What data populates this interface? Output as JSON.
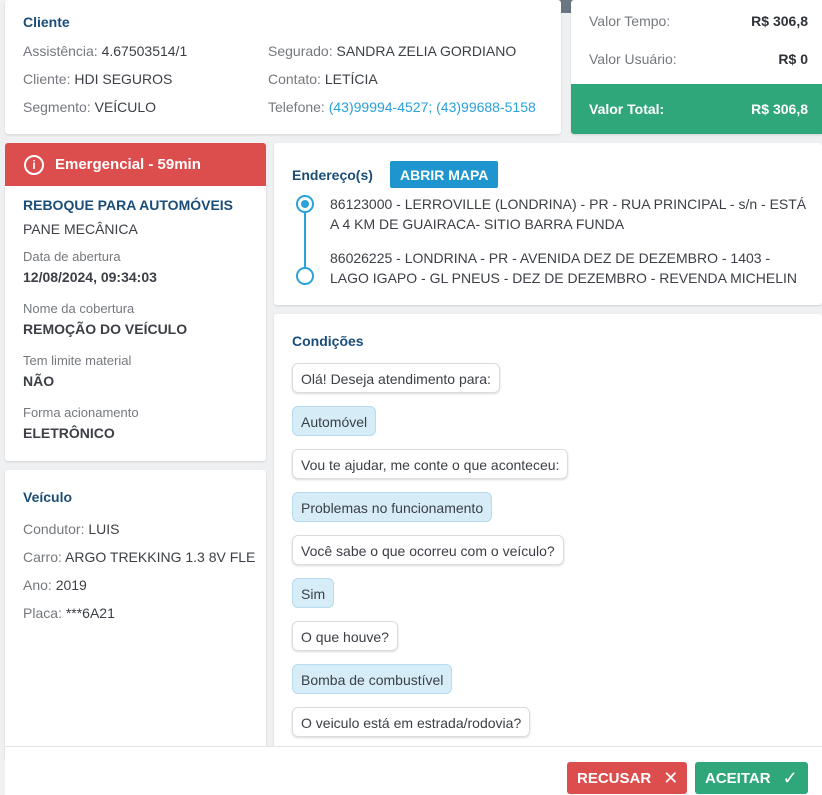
{
  "client": {
    "title": "Cliente",
    "assistance_label": "Assistência:",
    "assistance": "4.67503514/1",
    "client_label": "Cliente:",
    "client": "HDI SEGUROS",
    "segment_label": "Segmento:",
    "segment": "VEÍCULO",
    "insured_label": "Segurado:",
    "insured": "SANDRA ZELIA GORDIANO",
    "contact_label": "Contato:",
    "contact": "LETÍCIA",
    "phone_label": "Telefone:",
    "phone": "(43)99994-4527; (43)99688-5158"
  },
  "values": {
    "time_label": "Valor Tempo:",
    "time": "R$ 306,8",
    "user_label": "Valor Usuário:",
    "user": "R$ 0",
    "total_label": "Valor Total:",
    "total": "R$ 306,8"
  },
  "service": {
    "emergency": "Emergencial - 59min",
    "type": "REBOQUE PARA AUTOMÓVEIS",
    "problem": "PANE MECÂNICA",
    "opening_label": "Data de abertura",
    "opening": "12/08/2024, 09:34:03",
    "coverage_label": "Nome da cobertura",
    "coverage": "REMOÇÃO DO VEÍCULO",
    "material_label": "Tem limite material",
    "material": "NÃO",
    "trigger_label": "Forma acionamento",
    "trigger": "ELETRÔNICO"
  },
  "vehicle": {
    "title": "Veículo",
    "driver_label": "Condutor:",
    "driver": "LUIS",
    "car_label": "Carro:",
    "car": "ARGO TREKKING 1.3 8V FLE",
    "year_label": "Ano:",
    "year": "2019",
    "plate_label": "Placa:",
    "plate": "***6A21"
  },
  "address": {
    "title": "Endereço(s)",
    "map_button": "ABRIR MAPA",
    "origin": "86123000 - LERROVILLE (LONDRINA) - PR - RUA PRINCIPAL - s/n - ESTÁ A 4 KM DE GUAIRACA- SITIO BARRA FUNDA",
    "destination": "86026225 - LONDRINA - PR - AVENIDA DEZ DE DEZEMBRO - 1403 - LAGO IGAPO - GL PNEUS - DEZ DE DEZEMBRO - REVENDA MICHELIN"
  },
  "conditions": {
    "title": "Condições",
    "messages": [
      {
        "kind": "q",
        "text": "Olá! Deseja atendimento para:"
      },
      {
        "kind": "a",
        "text": "Automóvel"
      },
      {
        "kind": "q",
        "text": "Vou te ajudar, me conte o que aconteceu:"
      },
      {
        "kind": "a",
        "text": "Problemas no funcionamento"
      },
      {
        "kind": "q",
        "text": "Você sabe o que ocorreu com o veículo?"
      },
      {
        "kind": "a",
        "text": "Sim"
      },
      {
        "kind": "q",
        "text": "O que houve?"
      },
      {
        "kind": "a",
        "text": "Bomba de combustível"
      },
      {
        "kind": "q",
        "text": "O veiculo está em estrada/rodovia?"
      }
    ]
  },
  "actions": {
    "refuse": "RECUSAR",
    "accept": "ACEITAR"
  },
  "colors": {
    "brand_blue": "#1a4d78",
    "link": "#2aa1d9",
    "success": "#30a67b",
    "danger": "#dc4d4d"
  },
  "icons": {
    "emergency": "alert-circle-icon",
    "refuse": "close-icon",
    "accept": "check-icon"
  }
}
